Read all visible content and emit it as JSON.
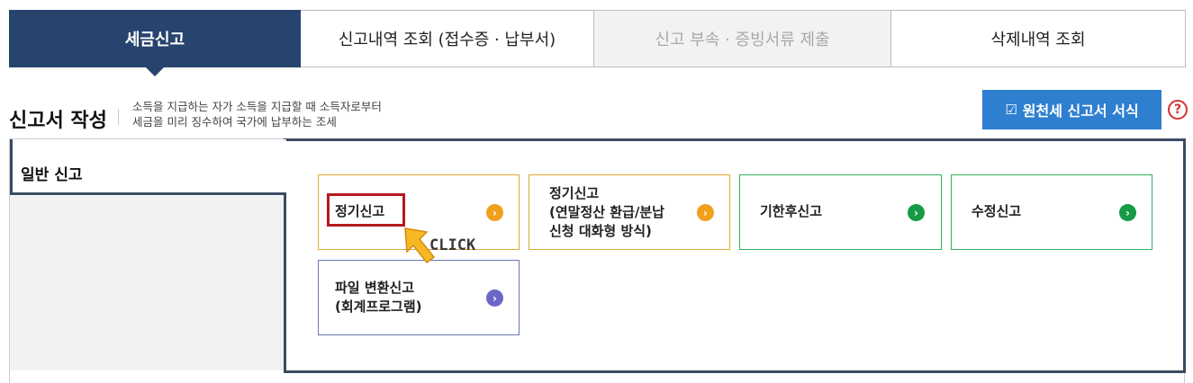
{
  "tabs": [
    {
      "label": "세금신고",
      "active": true
    },
    {
      "label": "신고내역 조회 (접수증 · 납부서)",
      "active": false
    },
    {
      "label": "신고 부속 · 증빙서류 제출",
      "disabled": true
    },
    {
      "label": "삭제내역 조회",
      "active": false
    }
  ],
  "header": {
    "title": "신고서 작성",
    "desc_line1": "소득을 지급하는 자가 소득을 지급할 때 소득자로부터",
    "desc_line2": "세금을 미리 징수하여 국가에 납부하는 조세",
    "form_button_label": "원천세 신고서 서식",
    "form_button_icon": "edit-icon",
    "help_symbol": "?"
  },
  "panel": {
    "subtab_label": "일반 신고",
    "options": [
      {
        "label": "정기신고",
        "color": "orange",
        "highlighted": true
      },
      {
        "label": "정기신고\n(연말정산 환급/분납\n신청 대화형 방식)",
        "color": "orange"
      },
      {
        "label": "기한후신고",
        "color": "green"
      },
      {
        "label": "수정신고",
        "color": "green"
      },
      {
        "label": "파일 변환신고\n(회계프로그램)",
        "color": "purple"
      }
    ]
  },
  "annotation": {
    "click_text": "CLICK"
  },
  "colors": {
    "tab_active": "#27446f",
    "button_blue": "#2e7fd0",
    "orange": "#f0a11b",
    "green": "#159a45",
    "purple": "#6a67c7",
    "highlight_red": "#b5191f"
  }
}
